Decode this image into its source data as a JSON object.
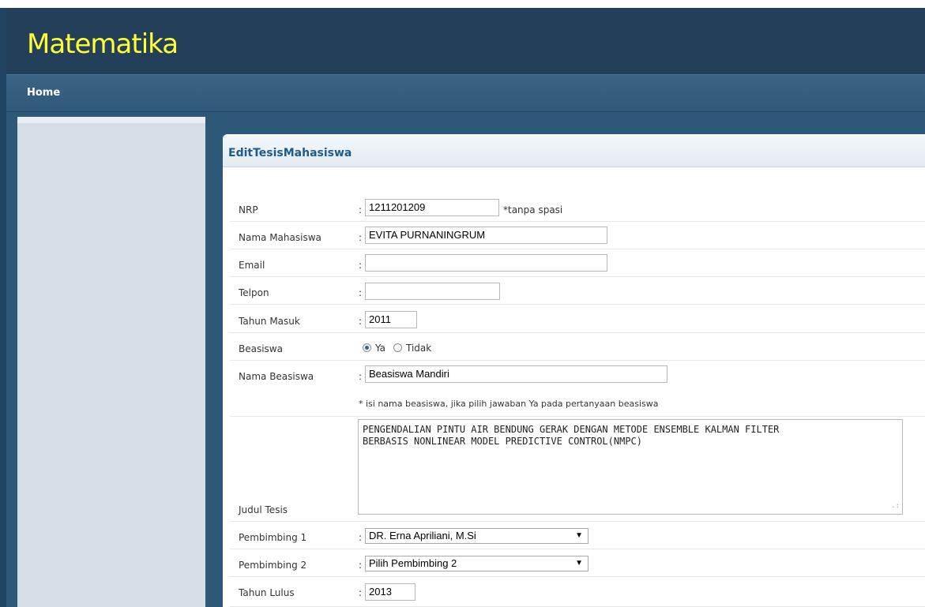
{
  "header": {
    "logo": "Matematika"
  },
  "nav": {
    "home": "Home"
  },
  "panel": {
    "title": "EditTesisMahasiswa"
  },
  "form": {
    "colon": ":",
    "nrp": {
      "label": "NRP",
      "value": "1211201209",
      "hint": "*tanpa spasi"
    },
    "nama": {
      "label": "Nama Mahasiswa",
      "value": "EVITA PURNANINGRUM"
    },
    "email": {
      "label": "Email",
      "value": ""
    },
    "telpon": {
      "label": "Telpon",
      "value": ""
    },
    "tahun_masuk": {
      "label": "Tahun Masuk",
      "value": "2011"
    },
    "beasiswa": {
      "label": "Beasiswa",
      "option_ya": "Ya",
      "option_tidak": "Tidak",
      "selected": "Ya"
    },
    "nama_beasiswa": {
      "label": "Nama Beasiswa",
      "value": "Beasiswa Mandiri",
      "note": "* isi nama beasiswa, jika pilih jawaban Ya pada pertanyaan beasiswa"
    },
    "judul": {
      "label": "Judul Tesis",
      "value": "PENGENDALIAN PINTU AIR BENDUNG GERAK DENGAN METODE ENSEMBLE KALMAN FILTER\nBERBASIS NONLINEAR MODEL PREDICTIVE CONTROL(NMPC)"
    },
    "pembimbing1": {
      "label": "Pembimbing 1",
      "value": "DR. Erna Apriliani, M.Si"
    },
    "pembimbing2": {
      "label": "Pembimbing 2",
      "value": "Pilih Pembimbing 2"
    },
    "tahun_lulus": {
      "label": "Tahun Lulus",
      "value": "2013"
    }
  }
}
